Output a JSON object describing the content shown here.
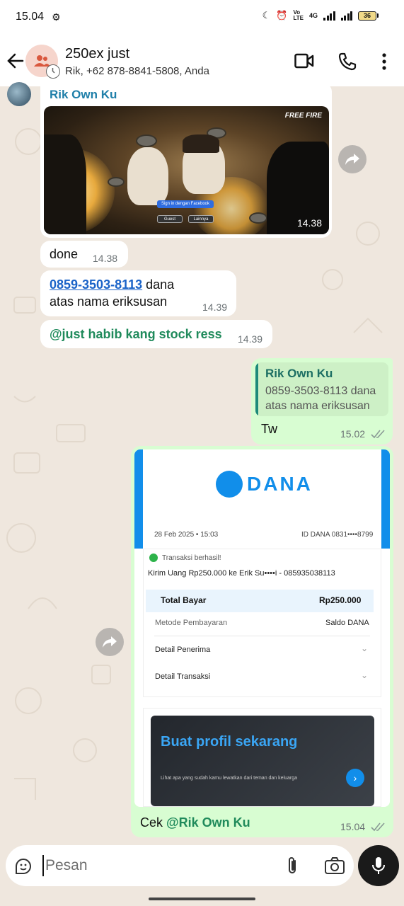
{
  "status_bar": {
    "time": "15.04",
    "network": "4G",
    "battery": "36"
  },
  "header": {
    "title": "250ex just",
    "subtitle": "Rik, +62 878-8841-5808, Anda"
  },
  "messages": {
    "m1": {
      "sender": "Rik Own Ku",
      "image_time": "14.38",
      "game_logo": "FREE FIRE",
      "game_btn_fb": "Sign in dengan Facebook",
      "game_btn_guest": "Guest",
      "game_btn_other": "Lainnya"
    },
    "m2": {
      "text": "done",
      "time": "14.38"
    },
    "m3": {
      "phone": "0859-3503-8113",
      "text_after": " dana",
      "line2": "atas nama eriksusan",
      "time": "14.39"
    },
    "m4": {
      "mention": "@just habib kang stock ress",
      "time": "14.39"
    },
    "m5": {
      "quote_sender": "Rik Own Ku",
      "quote_text": "0859-3503-8113 dana atas nama eriksusan",
      "text": "Tw",
      "time": "15.02"
    },
    "m6": {
      "caption_prefix": "Cek ",
      "caption_mention": "@Rik Own Ku",
      "time": "15.04",
      "dana": {
        "brand": "DANA",
        "date": "28 Feb 2025 • 15:03",
        "id": "ID DANA 0831••••8799",
        "status": "Transaksi berhasil!",
        "description": "Kirim Uang Rp250.000 ke Erik Su••••i - 085935038113",
        "total_label": "Total Bayar",
        "total_value": "Rp250.000",
        "method_label": "Metode Pembayaran",
        "method_value": "Saldo DANA",
        "detail1": "Detail Penerima",
        "detail2": "Detail Transaksi",
        "promo_title": "Buat profil sekarang",
        "promo_sub": "Lihat apa yang sudah kamu lewatkan dari teman dan keluarga"
      }
    }
  },
  "composer": {
    "placeholder": "Pesan"
  },
  "colors": {
    "incoming": "#ffffff",
    "outgoing": "#d8fdd2",
    "sender": "#1f7fa9",
    "mention": "#1f8a5b",
    "link": "#1a63c8",
    "dana_blue": "#118eea"
  }
}
